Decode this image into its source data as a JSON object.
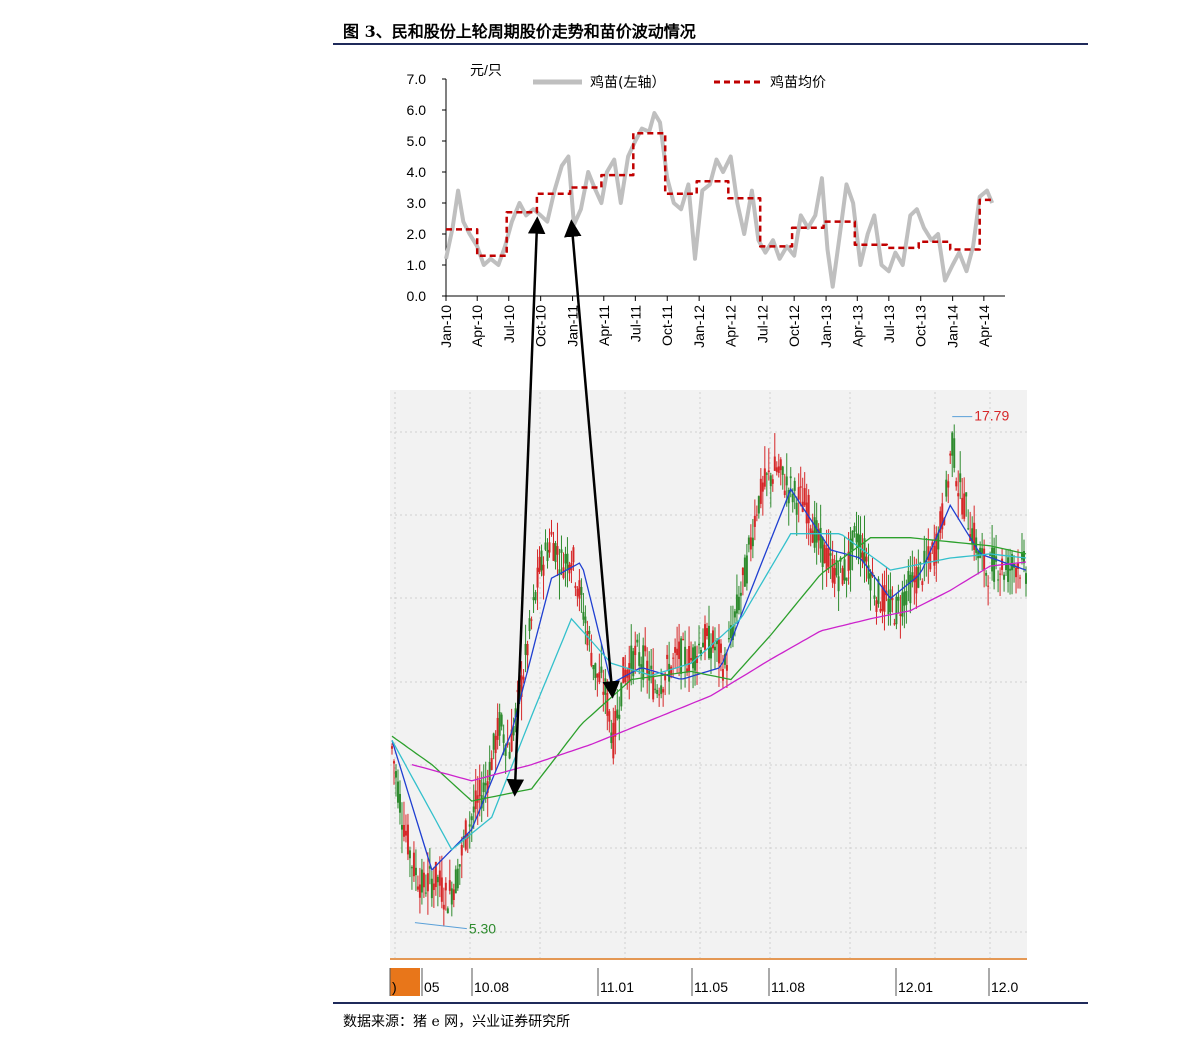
{
  "figure": {
    "title": "图 3、民和股份上轮周期股价走势和苗价波动情况",
    "source": "数据来源：猪 e 网，兴业证券研究所"
  },
  "chart_data": [
    {
      "type": "line",
      "unit_label": "元/只",
      "ylim": [
        0,
        7
      ],
      "y_ticks": [
        "0.0",
        "1.0",
        "2.0",
        "3.0",
        "4.0",
        "5.0",
        "6.0",
        "7.0"
      ],
      "x_ticks": [
        "Jan-10",
        "Apr-10",
        "Jul-10",
        "Oct-10",
        "Jan-11",
        "Apr-11",
        "Jul-11",
        "Oct-11",
        "Jan-12",
        "Apr-12",
        "Jul-12",
        "Oct-12",
        "Jan-13",
        "Apr-13",
        "Jul-13",
        "Oct-13",
        "Jan-14",
        "Apr-14"
      ],
      "legend_position": "top",
      "series": [
        {
          "name": "鸡苗(左轴）",
          "color": "#bfbfbf",
          "style": "solid",
          "points": [
            [
              "2010-01-01",
              1.2
            ],
            [
              "2010-01-20",
              2.2
            ],
            [
              "2010-02-05",
              3.4
            ],
            [
              "2010-02-20",
              2.4
            ],
            [
              "2010-03-10",
              2.0
            ],
            [
              "2010-04-01",
              1.6
            ],
            [
              "2010-04-20",
              1.0
            ],
            [
              "2010-05-10",
              1.2
            ],
            [
              "2010-06-01",
              1.0
            ],
            [
              "2010-06-20",
              1.6
            ],
            [
              "2010-07-10",
              2.4
            ],
            [
              "2010-08-01",
              3.0
            ],
            [
              "2010-08-20",
              2.6
            ],
            [
              "2010-09-10",
              2.8
            ],
            [
              "2010-10-01",
              2.6
            ],
            [
              "2010-10-20",
              2.4
            ],
            [
              "2010-11-10",
              3.4
            ],
            [
              "2010-12-01",
              4.2
            ],
            [
              "2010-12-20",
              4.5
            ],
            [
              "2011-01-05",
              2.3
            ],
            [
              "2011-01-25",
              2.8
            ],
            [
              "2011-02-15",
              4.0
            ],
            [
              "2011-03-05",
              3.5
            ],
            [
              "2011-03-25",
              3.0
            ],
            [
              "2011-04-10",
              4.0
            ],
            [
              "2011-05-01",
              4.4
            ],
            [
              "2011-05-20",
              3.0
            ],
            [
              "2011-06-10",
              4.5
            ],
            [
              "2011-07-01",
              5.0
            ],
            [
              "2011-07-20",
              5.4
            ],
            [
              "2011-08-10",
              5.3
            ],
            [
              "2011-08-25",
              5.9
            ],
            [
              "2011-09-10",
              5.6
            ],
            [
              "2011-10-01",
              3.8
            ],
            [
              "2011-10-20",
              3.0
            ],
            [
              "2011-11-10",
              2.8
            ],
            [
              "2011-12-01",
              3.6
            ],
            [
              "2011-12-20",
              1.2
            ],
            [
              "2012-01-10",
              3.4
            ],
            [
              "2012-02-01",
              3.6
            ],
            [
              "2012-02-20",
              4.4
            ],
            [
              "2012-03-10",
              4.0
            ],
            [
              "2012-04-01",
              4.5
            ],
            [
              "2012-04-20",
              3.0
            ],
            [
              "2012-05-10",
              2.0
            ],
            [
              "2012-06-01",
              3.4
            ],
            [
              "2012-06-20",
              1.8
            ],
            [
              "2012-07-10",
              1.4
            ],
            [
              "2012-08-01",
              1.8
            ],
            [
              "2012-08-20",
              1.2
            ],
            [
              "2012-09-10",
              1.6
            ],
            [
              "2012-10-01",
              1.3
            ],
            [
              "2012-10-20",
              2.6
            ],
            [
              "2012-11-10",
              2.2
            ],
            [
              "2012-12-01",
              2.6
            ],
            [
              "2012-12-20",
              3.8
            ],
            [
              "2013-01-05",
              1.5
            ],
            [
              "2013-01-20",
              0.3
            ],
            [
              "2013-02-10",
              2.0
            ],
            [
              "2013-03-01",
              3.6
            ],
            [
              "2013-03-20",
              3.0
            ],
            [
              "2013-04-10",
              1.0
            ],
            [
              "2013-05-01",
              2.0
            ],
            [
              "2013-05-20",
              2.6
            ],
            [
              "2013-06-10",
              1.0
            ],
            [
              "2013-07-01",
              0.8
            ],
            [
              "2013-07-20",
              1.4
            ],
            [
              "2013-08-10",
              1.0
            ],
            [
              "2013-09-01",
              2.6
            ],
            [
              "2013-09-20",
              2.8
            ],
            [
              "2013-10-10",
              2.2
            ],
            [
              "2013-11-01",
              1.8
            ],
            [
              "2013-11-20",
              2.0
            ],
            [
              "2013-12-10",
              0.5
            ],
            [
              "2014-01-01",
              1.0
            ],
            [
              "2014-01-20",
              1.4
            ],
            [
              "2014-02-10",
              0.8
            ],
            [
              "2014-03-01",
              1.6
            ],
            [
              "2014-03-20",
              3.2
            ],
            [
              "2014-04-10",
              3.4
            ],
            [
              "2014-04-25",
              3.0
            ]
          ]
        },
        {
          "name": "鸡苗均价",
          "color": "#c00000",
          "style": "dashed",
          "points": [
            [
              "2010-01-01",
              2.15
            ],
            [
              "2010-04-01",
              2.15
            ],
            [
              "2010-04-01",
              1.3
            ],
            [
              "2010-06-25",
              1.3
            ],
            [
              "2010-06-25",
              2.7
            ],
            [
              "2010-09-20",
              2.7
            ],
            [
              "2010-09-20",
              3.3
            ],
            [
              "2010-12-25",
              3.3
            ],
            [
              "2010-12-25",
              3.5
            ],
            [
              "2011-03-25",
              3.5
            ],
            [
              "2011-03-25",
              3.9
            ],
            [
              "2011-06-25",
              3.9
            ],
            [
              "2011-06-25",
              5.25
            ],
            [
              "2011-09-25",
              5.25
            ],
            [
              "2011-09-25",
              3.3
            ],
            [
              "2011-12-25",
              3.3
            ],
            [
              "2011-12-25",
              3.7
            ],
            [
              "2012-03-25",
              3.7
            ],
            [
              "2012-03-25",
              3.15
            ],
            [
              "2012-06-25",
              3.15
            ],
            [
              "2012-06-25",
              1.6
            ],
            [
              "2012-09-25",
              1.6
            ],
            [
              "2012-09-25",
              2.2
            ],
            [
              "2012-12-25",
              2.2
            ],
            [
              "2012-12-25",
              2.4
            ],
            [
              "2013-03-25",
              2.4
            ],
            [
              "2013-03-25",
              1.65
            ],
            [
              "2013-06-25",
              1.65
            ],
            [
              "2013-06-25",
              1.55
            ],
            [
              "2013-09-25",
              1.55
            ],
            [
              "2013-09-25",
              1.75
            ],
            [
              "2013-12-25",
              1.75
            ],
            [
              "2013-12-25",
              1.5
            ],
            [
              "2014-03-20",
              1.5
            ],
            [
              "2014-03-20",
              3.1
            ],
            [
              "2014-04-25",
              3.1
            ]
          ]
        }
      ]
    },
    {
      "type": "candlestick",
      "x_ticks": [
        ")",
        "05",
        "10.08",
        "11.01",
        "11.05",
        "11.08",
        "12.01",
        "12.0"
      ],
      "annotations": [
        {
          "text": "5.30",
          "color": "#2e8b2e"
        },
        {
          "text": "17.79",
          "color": "#d62728"
        }
      ],
      "price_range": [
        5.3,
        17.79
      ],
      "series": [
        {
          "name": "",
          "color": "#d62728",
          "style": "price",
          "points": [
            [
              0,
              9.6
            ],
            [
              10,
              8.0
            ],
            [
              20,
              6.8
            ],
            [
              30,
              6.2
            ],
            [
              45,
              6.4
            ],
            [
              55,
              5.9
            ],
            [
              65,
              6.4
            ],
            [
              75,
              7.6
            ],
            [
              85,
              8.2
            ],
            [
              95,
              8.8
            ],
            [
              108,
              10.2
            ],
            [
              118,
              9.6
            ],
            [
              128,
              10.9
            ],
            [
              138,
              12.4
            ],
            [
              148,
              14.0
            ],
            [
              160,
              14.8
            ],
            [
              170,
              14.2
            ],
            [
              180,
              14.4
            ],
            [
              192,
              13.0
            ],
            [
              204,
              11.5
            ],
            [
              214,
              11.0
            ],
            [
              222,
              9.8
            ],
            [
              232,
              11.4
            ],
            [
              244,
              11.9
            ],
            [
              254,
              11.7
            ],
            [
              264,
              11.1
            ],
            [
              276,
              11.5
            ],
            [
              288,
              11.9
            ],
            [
              300,
              11.8
            ],
            [
              312,
              12.3
            ],
            [
              324,
              12.1
            ],
            [
              334,
              11.6
            ],
            [
              344,
              12.8
            ],
            [
              356,
              14.1
            ],
            [
              366,
              15.6
            ],
            [
              376,
              16.2
            ],
            [
              386,
              16.5
            ],
            [
              396,
              16.1
            ],
            [
              406,
              15.8
            ],
            [
              416,
              15.6
            ],
            [
              426,
              14.8
            ],
            [
              436,
              14.3
            ],
            [
              446,
              13.9
            ],
            [
              456,
              14.0
            ],
            [
              466,
              14.9
            ],
            [
              476,
              14.3
            ],
            [
              486,
              13.4
            ],
            [
              496,
              13.2
            ],
            [
              506,
              13.0
            ],
            [
              516,
              13.5
            ],
            [
              526,
              13.8
            ],
            [
              536,
              14.1
            ],
            [
              546,
              14.6
            ],
            [
              556,
              15.8
            ],
            [
              562,
              17.2
            ],
            [
              568,
              16.1
            ],
            [
              576,
              15.5
            ],
            [
              586,
              14.6
            ],
            [
              596,
              14.0
            ],
            [
              606,
              14.2
            ],
            [
              616,
              14.0
            ],
            [
              626,
              14.2
            ],
            [
              636,
              14.0
            ]
          ]
        },
        {
          "name": "",
          "color": "#1f3fd1",
          "style": "ma",
          "points": [
            [
              0,
              9.8
            ],
            [
              40,
              6.6
            ],
            [
              80,
              7.6
            ],
            [
              120,
              10.0
            ],
            [
              160,
              13.8
            ],
            [
              190,
              14.2
            ],
            [
              220,
              11.2
            ],
            [
              250,
              11.6
            ],
            [
              290,
              11.3
            ],
            [
              330,
              11.6
            ],
            [
              360,
              13.5
            ],
            [
              400,
              16.0
            ],
            [
              440,
              14.5
            ],
            [
              470,
              14.3
            ],
            [
              500,
              13.3
            ],
            [
              530,
              13.9
            ],
            [
              560,
              15.6
            ],
            [
              590,
              14.4
            ],
            [
              636,
              14.0
            ]
          ]
        },
        {
          "name": "",
          "color": "#33c0cc",
          "style": "ma",
          "points": [
            [
              0,
              9.8
            ],
            [
              60,
              7.1
            ],
            [
              100,
              7.9
            ],
            [
              140,
              10.4
            ],
            [
              180,
              12.8
            ],
            [
              220,
              11.7
            ],
            [
              260,
              11.4
            ],
            [
              300,
              11.7
            ],
            [
              350,
              12.8
            ],
            [
              400,
              14.9
            ],
            [
              450,
              14.9
            ],
            [
              500,
              14.0
            ],
            [
              560,
              14.3
            ],
            [
              600,
              14.4
            ],
            [
              636,
              14.3
            ]
          ]
        },
        {
          "name": "",
          "color": "#2ca02c",
          "style": "ma",
          "points": [
            [
              0,
              9.9
            ],
            [
              40,
              9.2
            ],
            [
              80,
              8.3
            ],
            [
              140,
              8.6
            ],
            [
              190,
              10.2
            ],
            [
              240,
              11.3
            ],
            [
              300,
              11.5
            ],
            [
              340,
              11.3
            ],
            [
              380,
              12.4
            ],
            [
              430,
              13.9
            ],
            [
              480,
              14.8
            ],
            [
              520,
              14.8
            ],
            [
              560,
              14.7
            ],
            [
              600,
              14.6
            ],
            [
              636,
              14.4
            ]
          ]
        },
        {
          "name": "",
          "color": "#cc22cc",
          "style": "ma",
          "points": [
            [
              20,
              9.2
            ],
            [
              80,
              8.8
            ],
            [
              140,
              9.2
            ],
            [
              200,
              9.7
            ],
            [
              260,
              10.3
            ],
            [
              320,
              10.9
            ],
            [
              380,
              11.8
            ],
            [
              430,
              12.5
            ],
            [
              480,
              12.8
            ],
            [
              520,
              13.0
            ],
            [
              560,
              13.5
            ],
            [
              600,
              14.1
            ],
            [
              636,
              14.2
            ]
          ]
        }
      ]
    }
  ]
}
